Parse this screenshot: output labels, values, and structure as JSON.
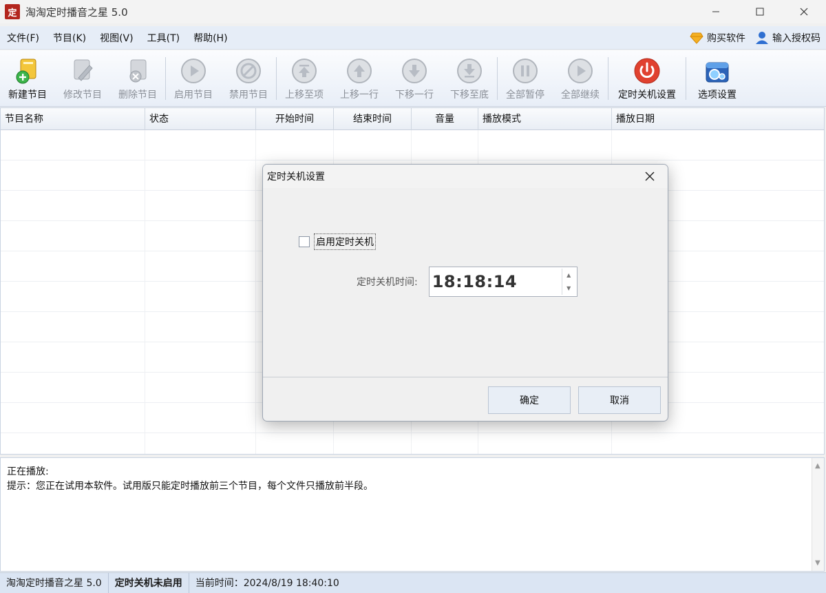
{
  "window": {
    "title": "淘淘定时播音之星 5.0",
    "app_icon_text": "定"
  },
  "menu": {
    "items": [
      "文件(F)",
      "节目(K)",
      "视图(V)",
      "工具(T)",
      "帮助(H)"
    ],
    "buy": "购买软件",
    "license": "输入授权码"
  },
  "toolbar": {
    "items": [
      {
        "label": "新建节目",
        "icon": "add-program-icon",
        "enabled": true
      },
      {
        "label": "修改节目",
        "icon": "edit-program-icon",
        "enabled": false
      },
      {
        "label": "删除节目",
        "icon": "delete-program-icon",
        "enabled": false
      },
      {
        "label": "启用节目",
        "icon": "enable-play-icon",
        "enabled": false
      },
      {
        "label": "禁用节目",
        "icon": "disable-icon",
        "enabled": false
      },
      {
        "label": "上移至项",
        "icon": "move-top-icon",
        "enabled": false
      },
      {
        "label": "上移一行",
        "icon": "move-up-icon",
        "enabled": false
      },
      {
        "label": "下移一行",
        "icon": "move-down-icon",
        "enabled": false
      },
      {
        "label": "下移至底",
        "icon": "move-bottom-icon",
        "enabled": false
      },
      {
        "label": "全部暂停",
        "icon": "pause-all-icon",
        "enabled": false
      },
      {
        "label": "全部继续",
        "icon": "resume-all-icon",
        "enabled": false
      },
      {
        "label": "定时关机设置",
        "icon": "power-icon",
        "enabled": true
      },
      {
        "label": "选项设置",
        "icon": "options-icon",
        "enabled": true
      }
    ]
  },
  "table": {
    "columns": [
      "节目名称",
      "状态",
      "开始时间",
      "结束时间",
      "音量",
      "播放模式",
      "播放日期"
    ]
  },
  "info": {
    "now_playing": "正在播放:",
    "hint": "提示：您正在试用本软件。试用版只能定时播放前三个节目，每个文件只播放前半段。"
  },
  "status": {
    "app": "淘淘定时播音之星 5.0",
    "shutdown": "定时关机未启用",
    "time": "当前时间：2024/8/19 18:40:10"
  },
  "dialog": {
    "title": "定时关机设置",
    "checkbox_label": "启用定时关机",
    "checkbox_checked": false,
    "time_label": "定时关机时间:",
    "time_value": "18:18:14",
    "ok": "确定",
    "cancel": "取消"
  },
  "colors": {
    "accent": "#2f6fd1",
    "power": "#e0412f",
    "disabled_text": "#8a8f97"
  }
}
